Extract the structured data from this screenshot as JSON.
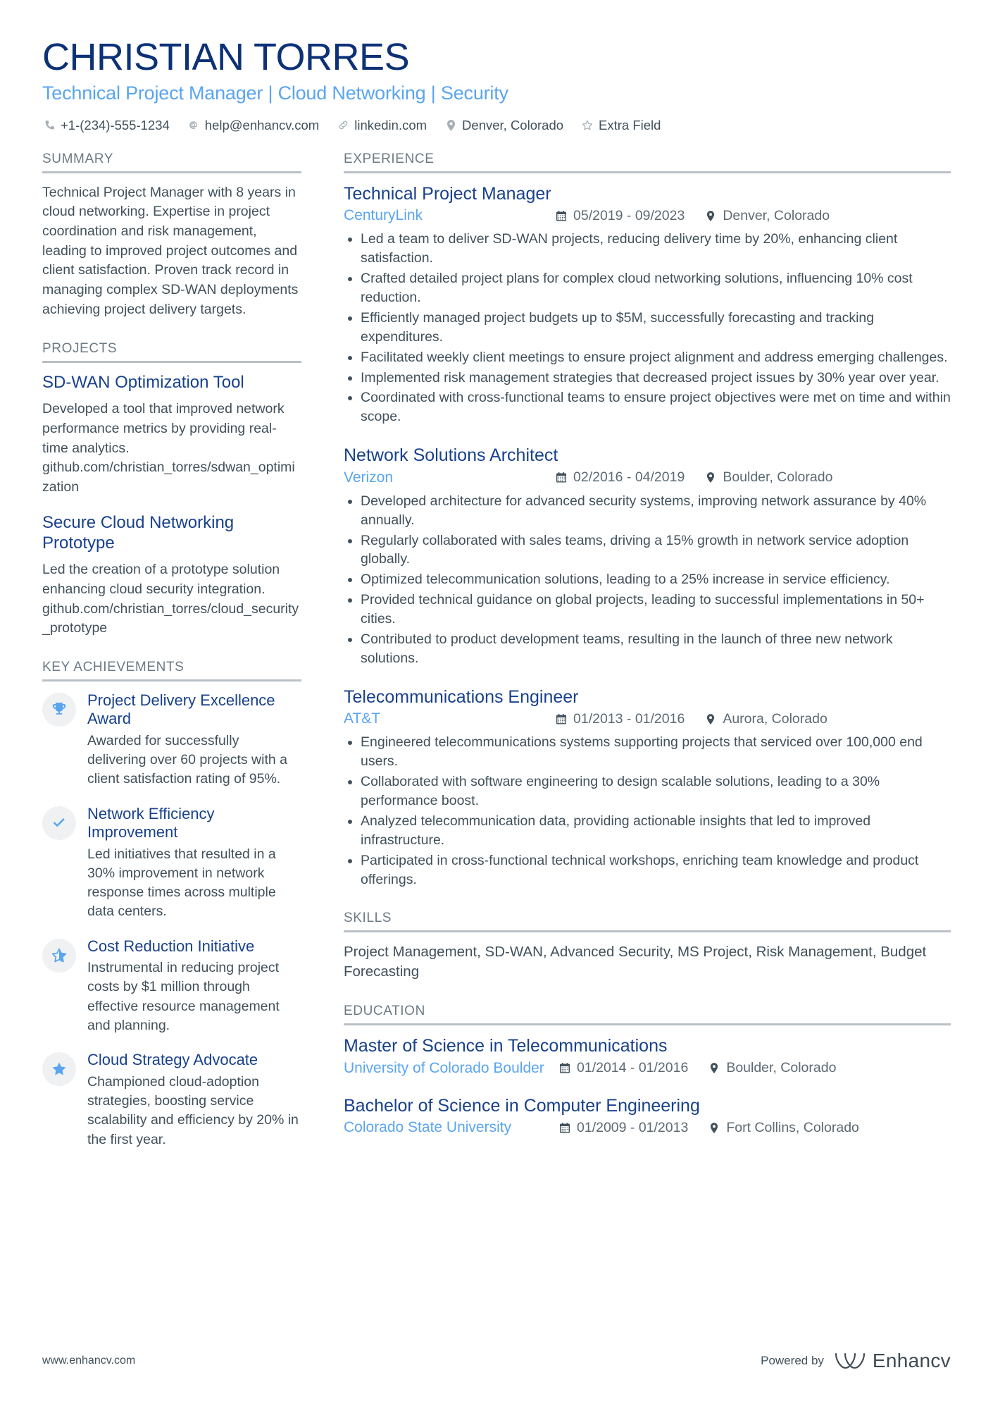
{
  "colors": {
    "navy": "#0c3177",
    "heading_blue": "#18418c",
    "accent_blue": "#5aa5f0",
    "body_gray": "#41505b",
    "label_gray": "#6d7a85",
    "rule_gray": "#b9c0c6"
  },
  "header": {
    "name": "CHRISTIAN TORRES",
    "headline": "Technical Project Manager | Cloud Networking | Security",
    "contacts": [
      {
        "icon": "phone-icon",
        "text": "+1-(234)-555-1234"
      },
      {
        "icon": "email-icon",
        "text": "help@enhancv.com"
      },
      {
        "icon": "link-icon",
        "text": "linkedin.com"
      },
      {
        "icon": "location-icon",
        "text": "Denver, Colorado"
      },
      {
        "icon": "star-outline-icon",
        "text": "Extra Field"
      }
    ]
  },
  "sections": {
    "summary_title": "SUMMARY",
    "projects_title": "PROJECTS",
    "achievements_title": "KEY ACHIEVEMENTS",
    "experience_title": "EXPERIENCE",
    "skills_title": "SKILLS",
    "education_title": "EDUCATION"
  },
  "summary": {
    "text": "Technical Project Manager with 8 years in cloud networking. Expertise in project coordination and risk management, leading to improved project outcomes and client satisfaction. Proven track record in managing complex SD-WAN deployments achieving project delivery targets."
  },
  "projects": [
    {
      "title": "SD-WAN Optimization Tool",
      "description": "Developed a tool that improved network performance metrics by providing real-time analytics. github.com/christian_torres/sdwan_optimization"
    },
    {
      "title": "Secure Cloud Networking Prototype",
      "description": "Led the creation of a prototype solution enhancing cloud security integration. github.com/christian_torres/cloud_security_prototype"
    }
  ],
  "achievements": [
    {
      "icon": "trophy-icon",
      "title": "Project Delivery Excellence Award",
      "description": "Awarded for successfully delivering over 60 projects with a client satisfaction rating of 95%."
    },
    {
      "icon": "check-icon",
      "title": "Network Efficiency Improvement",
      "description": "Led initiatives that resulted in a 30% improvement in network response times across multiple data centers."
    },
    {
      "icon": "half-star-icon",
      "title": "Cost Reduction Initiative",
      "description": "Instrumental in reducing project costs by $1 million through effective resource management and planning."
    },
    {
      "icon": "star-icon",
      "title": "Cloud Strategy Advocate",
      "description": "Championed cloud-adoption strategies, boosting service scalability and efficiency by 20% in the first year."
    }
  ],
  "experience": [
    {
      "title": "Technical Project Manager",
      "company": "CenturyLink",
      "dates": "05/2019 - 09/2023",
      "location": "Denver, Colorado",
      "bullets": [
        "Led a team to deliver SD-WAN projects, reducing delivery time by 20%, enhancing client satisfaction.",
        "Crafted detailed project plans for complex cloud networking solutions, influencing 10% cost reduction.",
        "Efficiently managed project budgets up to $5M, successfully forecasting and tracking expenditures.",
        "Facilitated weekly client meetings to ensure project alignment and address emerging challenges.",
        "Implemented risk management strategies that decreased project issues by 30% year over year.",
        "Coordinated with cross-functional teams to ensure project objectives were met on time and within scope."
      ]
    },
    {
      "title": "Network Solutions Architect",
      "company": "Verizon",
      "dates": "02/2016 - 04/2019",
      "location": "Boulder, Colorado",
      "bullets": [
        "Developed architecture for advanced security systems, improving network assurance by 40% annually.",
        "Regularly collaborated with sales teams, driving a 15% growth in network service adoption globally.",
        "Optimized telecommunication solutions, leading to a 25% increase in service efficiency.",
        "Provided technical guidance on global projects, leading to successful implementations in 50+ cities.",
        "Contributed to product development teams, resulting in the launch of three new network solutions."
      ]
    },
    {
      "title": "Telecommunications Engineer",
      "company": "AT&T",
      "dates": "01/2013 - 01/2016",
      "location": "Aurora, Colorado",
      "bullets": [
        "Engineered telecommunications systems supporting projects that serviced over 100,000 end users.",
        "Collaborated with software engineering to design scalable solutions, leading to a 30% performance boost.",
        "Analyzed telecommunication data, providing actionable insights that led to improved infrastructure.",
        "Participated in cross-functional technical workshops, enriching team knowledge and product offerings."
      ]
    }
  ],
  "skills": {
    "text": "Project Management, SD-WAN, Advanced Security, MS Project, Risk Management, Budget Forecasting"
  },
  "education": [
    {
      "degree": "Master of Science in Telecommunications",
      "school": "University of Colorado Boulder",
      "dates": "01/2014 - 01/2016",
      "location": "Boulder, Colorado"
    },
    {
      "degree": "Bachelor of Science in Computer Engineering",
      "school": "Colorado State University",
      "dates": "01/2009 - 01/2013",
      "location": "Fort Collins, Colorado"
    }
  ],
  "footer": {
    "url": "www.enhancv.com",
    "powered_by": "Powered by",
    "brand": "Enhancv"
  }
}
